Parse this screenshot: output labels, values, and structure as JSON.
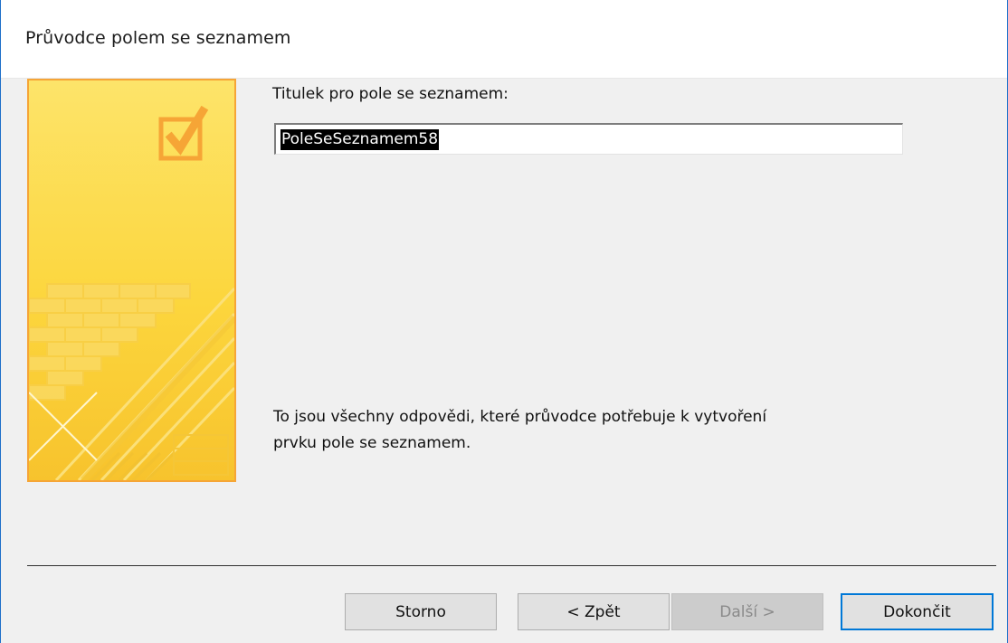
{
  "window": {
    "title": "Průvodce polem se seznamem"
  },
  "form": {
    "caption_label": "Titulek pro pole se seznamem:",
    "caption_value": "PoleSeSeznamem58",
    "info_line1": "To jsou všechny odpovědi, které průvodce potřebuje k vytvoření",
    "info_line2": "prvku pole se seznamem."
  },
  "buttons": {
    "cancel": "Storno",
    "back": "< Zpět",
    "next": "Další >",
    "finish": "Dokončit"
  },
  "illustration": {
    "icon": "checkbox-check-icon",
    "accent": "#f6a536"
  }
}
